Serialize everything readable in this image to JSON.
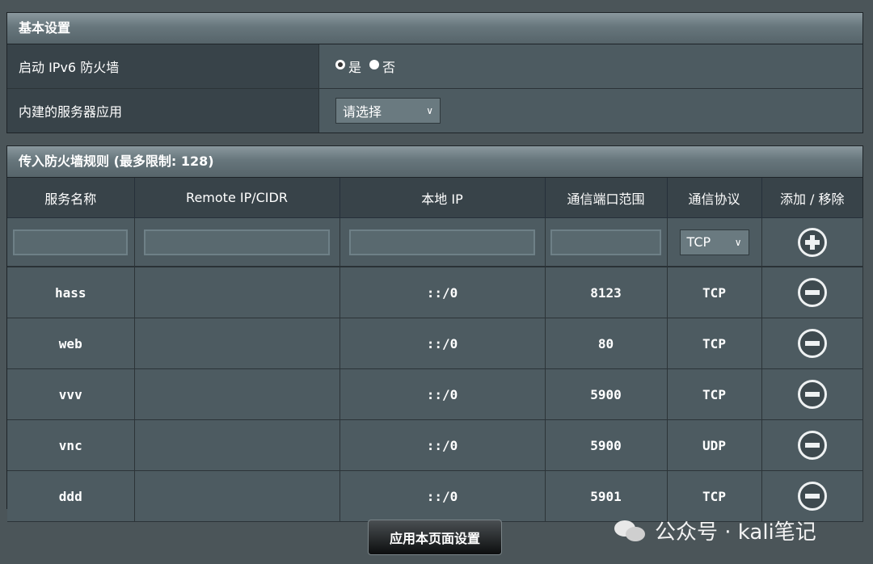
{
  "basic": {
    "title": "基本设置",
    "ipv6_label": "启动 IPv6 防火墙",
    "radio_yes": "是",
    "radio_no": "否",
    "server_label": "内建的服务器应用",
    "server_select": "请选择"
  },
  "rules": {
    "title": "传入防火墙规则 (最多限制: 128)",
    "columns": [
      "服务名称",
      "Remote IP/CIDR",
      "本地 IP",
      "通信端口范围",
      "通信协议",
      "添加 / 移除"
    ],
    "new_protocol": "TCP",
    "rows": [
      {
        "name": "hass",
        "remote": "",
        "local": "::/0",
        "port": "8123",
        "proto": "TCP"
      },
      {
        "name": "web",
        "remote": "",
        "local": "::/0",
        "port": "80",
        "proto": "TCP"
      },
      {
        "name": "vvv",
        "remote": "",
        "local": "::/0",
        "port": "5900",
        "proto": "TCP"
      },
      {
        "name": "vnc",
        "remote": "",
        "local": "::/0",
        "port": "5900",
        "proto": "UDP"
      },
      {
        "name": "ddd",
        "remote": "",
        "local": "::/0",
        "port": "5901",
        "proto": "TCP"
      }
    ]
  },
  "apply_label": "应用本页面设置",
  "watermark": "公众号 · kali笔记"
}
